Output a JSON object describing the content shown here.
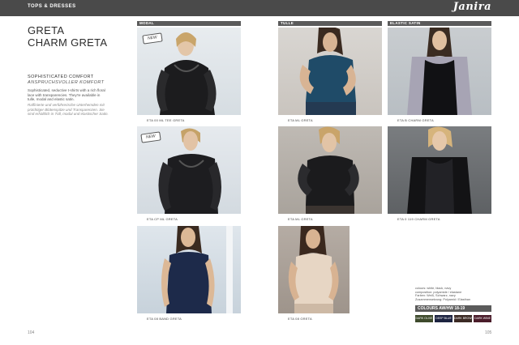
{
  "header": {
    "section": "TOPS & DRESSES",
    "brand": "Janira"
  },
  "intro": {
    "title_line1": "GRETA",
    "title_line2": "CHARM GRETA",
    "subtitle_en": "SOPHISTICATED COMFORT",
    "subtitle_de": "ANSPRUCHSVOLLER KOMFORT",
    "text_en": "Sophisticated, seductive t-shirts with a rich floral lace with transparencies. They're available in tulle, modal and elastic satin.",
    "text_de": "Raffinierte und verführerische Unterhemden mit prächtiger Blütenspitze und Transparenzen. Sie sind erhältlich in Tüll, modal und elastischer Satin."
  },
  "bars": {
    "modal": "MODAL",
    "tulle": "TULLE",
    "satin": "ELASTIC SATIN"
  },
  "badges": {
    "new": "NEW"
  },
  "captions": {
    "c1": "ETA 00 ML TEE GRETA",
    "c2": "ETA ML GRETA",
    "c3": "ETA B CHARM GRETA",
    "c4": "ETA CP ML GRETA",
    "c5": "ETA ML GRETA",
    "c6": "ETA 0 119 CHARM GRETA",
    "c7": "ETA 08 BAND GRETA",
    "c8": "ETA 08 GRETA"
  },
  "colors": {
    "note": "colours: white, black, navy\ncomposition: polyamide / elastane\nFarben: Weiß, Schwarz, navy\nZusammensetzung: Polyamid / Elasthan",
    "title": "COLOURS AW/HW 18-19",
    "swatches": [
      {
        "label": "DARK OLIVE",
        "hex": "#3e4a2c"
      },
      {
        "label": "DEEP BLUE",
        "hex": "#1c2340"
      },
      {
        "label": "DARK BROWN",
        "hex": "#3b2a24"
      },
      {
        "label": "DARK WINE",
        "hex": "#4a1c2a"
      }
    ]
  },
  "pages": {
    "left": "104",
    "right": "105"
  }
}
